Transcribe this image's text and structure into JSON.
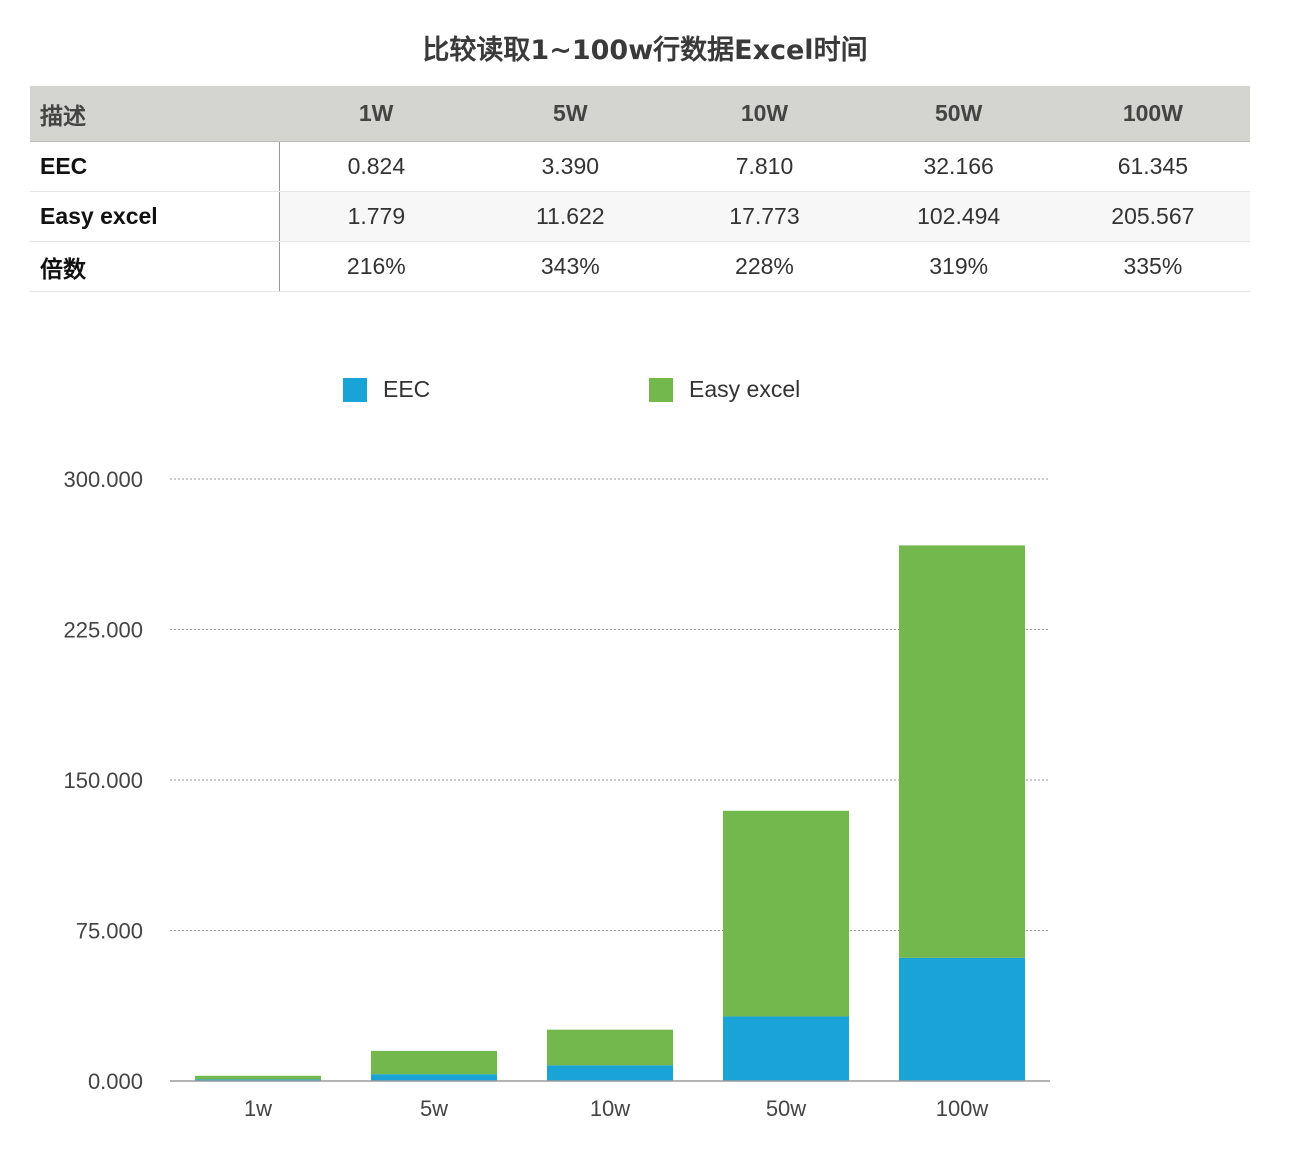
{
  "title": "比较读取1~100w行数据Excel时间",
  "table": {
    "corner": "描述",
    "columns": [
      "1W",
      "5W",
      "10W",
      "50W",
      "100W"
    ],
    "rows": [
      {
        "label": "EEC",
        "cells": [
          "0.824",
          "3.390",
          "7.810",
          "32.166",
          "61.345"
        ]
      },
      {
        "label": "Easy excel",
        "cells": [
          "1.779",
          "11.622",
          "17.773",
          "102.494",
          "205.567"
        ]
      },
      {
        "label": "倍数",
        "cells": [
          "216%",
          "343%",
          "228%",
          "319%",
          "335%"
        ]
      }
    ]
  },
  "legend": {
    "items": [
      {
        "label": "EEC",
        "color": "#1aa3d6"
      },
      {
        "label": "Easy excel",
        "color": "#72b84d"
      }
    ]
  },
  "chart_data": {
    "type": "bar",
    "stacked": true,
    "categories": [
      "1w",
      "5w",
      "10w",
      "50w",
      "100w"
    ],
    "series": [
      {
        "name": "EEC",
        "values": [
          0.824,
          3.39,
          7.81,
          32.166,
          61.345
        ],
        "color": "#1aa3d6"
      },
      {
        "name": "Easy excel",
        "values": [
          1.779,
          11.622,
          17.773,
          102.494,
          205.567
        ],
        "color": "#72b84d"
      }
    ],
    "ylim": [
      0,
      300
    ],
    "yticks": [
      0,
      75,
      150,
      225,
      300
    ],
    "ytick_labels": [
      "0.000",
      "75.000",
      "150.000",
      "225.000",
      "300.000"
    ],
    "grid": true,
    "legend_position": "top",
    "title": "",
    "xlabel": "",
    "ylabel": ""
  }
}
